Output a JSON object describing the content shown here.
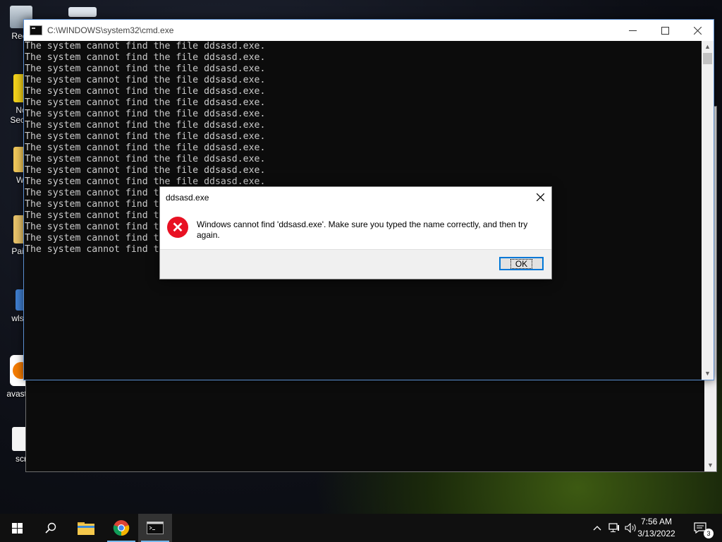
{
  "desktop": {
    "icons": [
      {
        "label": "Recy",
        "icon": "recycle-bin-icon"
      },
      {
        "label": "No\nSecur",
        "icon": "shortcut-icon"
      },
      {
        "label": "Wi",
        "icon": "shortcut-icon"
      },
      {
        "label": "Paint",
        "icon": "folder-icon"
      },
      {
        "label": "wlset",
        "icon": "app-icon"
      },
      {
        "label": "avast_c",
        "icon": "avast-icon"
      },
      {
        "label": "scr",
        "icon": "settings-file-icon"
      }
    ]
  },
  "cmd_window": {
    "title": "C:\\WINDOWS\\system32\\cmd.exe",
    "lines": [
      "The system cannot find the file ddsasd.exe.",
      "The system cannot find the file ddsasd.exe.",
      "The system cannot find the file ddsasd.exe.",
      "The system cannot find the file ddsasd.exe.",
      "The system cannot find the file ddsasd.exe.",
      "The system cannot find the file ddsasd.exe.",
      "The system cannot find the file ddsasd.exe.",
      "The system cannot find the file ddsasd.exe.",
      "The system cannot find the file ddsasd.exe.",
      "The system cannot find the file ddsasd.exe.",
      "The system cannot find the file ddsasd.exe.",
      "The system cannot find the file ddsasd.exe.",
      "The system cannot find the file ddsasd.exe.",
      "The system cannot find the file ddsasd.exe.",
      "The system cannot find the file ddsasd.exe.",
      "The system cannot find the file ddsasd.exe.",
      "The system cannot find the file ddsasd.exe.",
      "The system cannot find the file ddsasd.exe.",
      "The system cannot find the file ddsasd.exe."
    ],
    "minimize_icon": "minimize-icon",
    "maximize_icon": "maximize-icon",
    "close_icon": "close-icon"
  },
  "message_box": {
    "title": "ddsasd.exe",
    "icon": "error-icon",
    "message": "Windows cannot find 'ddsasd.exe'. Make sure you typed the name correctly, and then try again.",
    "ok_label": "OK",
    "colors": {
      "error": "#e81123",
      "focus": "#0078d7"
    }
  },
  "taskbar": {
    "pinned": [
      "start-icon",
      "search-icon",
      "file-explorer-icon",
      "chrome-icon",
      "cmd-icon"
    ],
    "time": "7:56 AM",
    "date": "3/13/2022",
    "notification_count": "3"
  }
}
